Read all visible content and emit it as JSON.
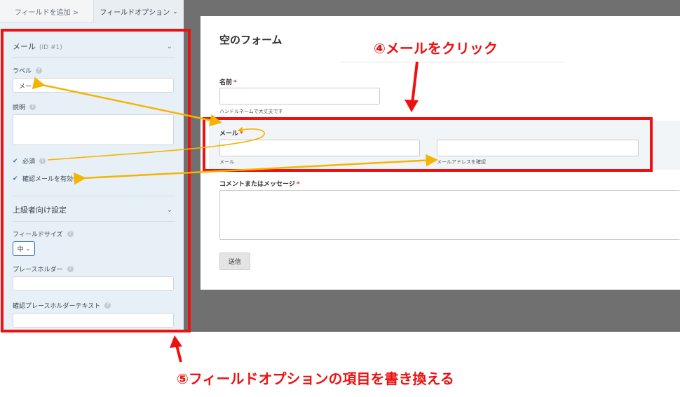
{
  "tabs": {
    "add_field": "フィールドを追加 >",
    "field_options": "フィールドオプション",
    "field_options_chevron": "⌄"
  },
  "sidebar": {
    "email_section": {
      "title": "メール",
      "id": "(ID #1)"
    },
    "label_field": {
      "label": "ラベル",
      "value": "メール"
    },
    "description_field": {
      "label": "説明"
    },
    "required": {
      "label": "必須",
      "checked": true
    },
    "confirm_email": {
      "label": "確認メールを有効化",
      "checked": true
    },
    "advanced_section": {
      "title": "上級者向け設定"
    },
    "field_size": {
      "label": "フィールドサイズ",
      "value": "中"
    },
    "placeholder": {
      "label": "プレースホルダー"
    },
    "confirm_placeholder": {
      "label": "確認プレースホルダーテキスト"
    }
  },
  "form": {
    "title": "空のフォーム",
    "name_label": "名前",
    "name_sub": "ハンドルネームで大丈夫です",
    "email_label": "メール",
    "email_sub": "メール",
    "email_confirm_sub": "メールアドレスを確認",
    "comment_label": "コメントまたはメッセージ",
    "required_mark": "*",
    "submit_label": "送信"
  },
  "annotations": {
    "step4": "④メールをクリック",
    "step5": "⑤フィールドオプションの項目を書き換える"
  },
  "colors": {
    "annotation_red": "#ee1111",
    "arrow_orange": "#f5b400",
    "sidebar_bg": "#e8f0f7",
    "dark_bg": "#707070"
  }
}
